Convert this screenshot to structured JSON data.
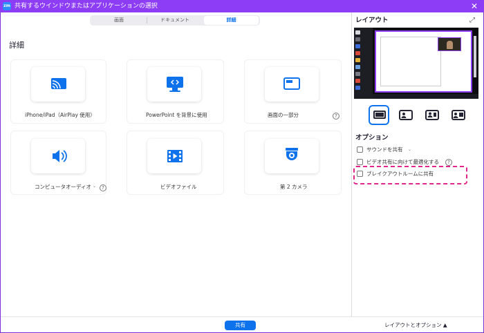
{
  "window": {
    "title": "共有するウインドウまたはアプリケーションの選択",
    "app_icon": "zm",
    "close_glyph": "✕"
  },
  "tabs": [
    "画面",
    "ドキュメント",
    "詳細"
  ],
  "selected_tab": "詳細",
  "section_title": "詳細",
  "cards": [
    {
      "label": "iPhone/iPad（AirPlay 使用）",
      "icon": "airplay-cast-icon"
    },
    {
      "label": "PowerPoint を背景に使用",
      "icon": "presentation-screen-icon"
    },
    {
      "label": "画面の一部分",
      "icon": "screen-portion-icon",
      "help": "?"
    },
    {
      "label": "コンピュータオーディオ",
      "icon": "speaker-icon",
      "dropdown": "⌄",
      "help": "?"
    },
    {
      "label": "ビデオファイル",
      "icon": "video-file-icon"
    },
    {
      "label": "第 2 カメラ",
      "icon": "camera-icon"
    }
  ],
  "right_panel": {
    "title": "レイアウト",
    "expand_glyph": "⤢",
    "layout_options": [
      "screen-only",
      "screen-with-camera-left",
      "screen-with-camera-right",
      "camera-and-screen-side"
    ],
    "options_title": "オプション",
    "options": [
      {
        "label": "サウンドを共有",
        "dropdown": "⌄",
        "checked": false
      },
      {
        "label": "ビデオ共有に向けて最適化する",
        "help": "?",
        "checked": false
      },
      {
        "label": "ブレイクアウトルームに共有",
        "checked": false,
        "highlighted": true
      }
    ]
  },
  "footer": {
    "share_label": "共有",
    "layout_options_label": "レイアウトとオプション ▲"
  },
  "colors": {
    "titlebar": "#8d3df5",
    "accent": "#0e72ed",
    "highlight_dash": "#e0248c"
  }
}
